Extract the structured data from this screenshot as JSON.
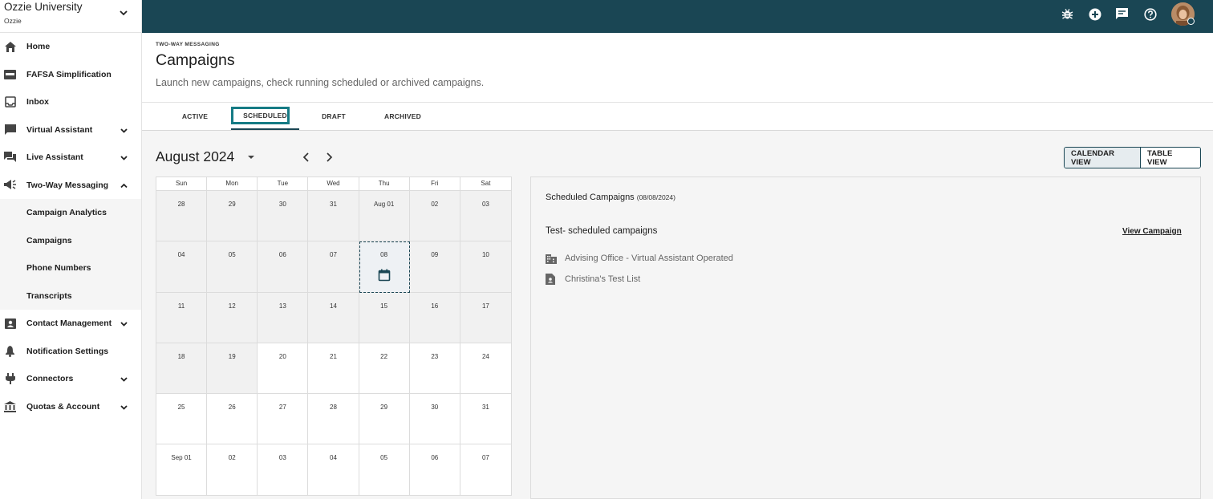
{
  "org": {
    "name": "Ozzie University",
    "sub": "Ozzie"
  },
  "sidebar": {
    "items": [
      {
        "label": "Home"
      },
      {
        "label": "FAFSA Simplification"
      },
      {
        "label": "Inbox"
      },
      {
        "label": "Virtual Assistant"
      },
      {
        "label": "Live Assistant"
      },
      {
        "label": "Two-Way Messaging"
      },
      {
        "label": "Contact Management"
      },
      {
        "label": "Notification Settings"
      },
      {
        "label": "Connectors"
      },
      {
        "label": "Quotas & Account"
      }
    ],
    "subitems": [
      {
        "label": "Campaign Analytics"
      },
      {
        "label": "Campaigns"
      },
      {
        "label": "Phone Numbers"
      },
      {
        "label": "Transcripts"
      }
    ]
  },
  "header": {
    "eyebrow": "TWO-WAY MESSAGING",
    "title": "Campaigns",
    "subtitle": "Launch new campaigns, check running scheduled or archived campaigns."
  },
  "tabs": [
    {
      "label": "ACTIVE"
    },
    {
      "label": "SCHEDULED"
    },
    {
      "label": "DRAFT"
    },
    {
      "label": "ARCHIVED"
    }
  ],
  "calendar": {
    "month": "August 2024",
    "weekdays": [
      "Sun",
      "Mon",
      "Tue",
      "Wed",
      "Thu",
      "Fri",
      "Sat"
    ],
    "days": [
      "28",
      "29",
      "30",
      "31",
      "Aug 01",
      "02",
      "03",
      "04",
      "05",
      "06",
      "07",
      "08",
      "09",
      "10",
      "11",
      "12",
      "13",
      "14",
      "15",
      "16",
      "17",
      "18",
      "19",
      "20",
      "21",
      "22",
      "23",
      "24",
      "25",
      "26",
      "27",
      "28",
      "29",
      "30",
      "31",
      "Sep 01",
      "02",
      "03",
      "04",
      "05",
      "06",
      "07"
    ]
  },
  "views": {
    "calendar": "CALENDAR VIEW",
    "table": "TABLE VIEW"
  },
  "panel": {
    "title": "Scheduled Campaigns",
    "date": "(08/08/2024)",
    "campaign_name": "Test- scheduled campaigns",
    "link": "View Campaign",
    "office": "Advising Office - Virtual Assistant Operated",
    "list": "Christina's Test List"
  },
  "colors": {
    "topbar": "#1a4654",
    "accent": "#167b85"
  }
}
